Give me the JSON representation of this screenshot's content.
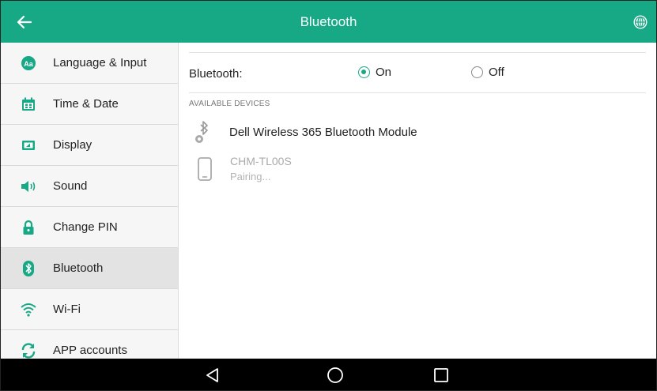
{
  "header": {
    "title": "Bluetooth",
    "back_icon": "arrow-left-icon",
    "globe_icon": "globe-icon",
    "background_color": "#17a886"
  },
  "sidebar": {
    "items": [
      {
        "label": "Language & Input",
        "icon": "language-icon",
        "active": false
      },
      {
        "label": "Time & Date",
        "icon": "calendar-icon",
        "active": false
      },
      {
        "label": "Display",
        "icon": "display-icon",
        "active": false
      },
      {
        "label": "Sound",
        "icon": "speaker-icon",
        "active": false
      },
      {
        "label": "Change PIN",
        "icon": "lock-icon",
        "active": false
      },
      {
        "label": "Bluetooth",
        "icon": "bluetooth-icon",
        "active": true
      },
      {
        "label": "Wi-Fi",
        "icon": "wifi-icon",
        "active": false
      },
      {
        "label": "APP accounts",
        "icon": "sync-icon",
        "active": false
      }
    ]
  },
  "bluetooth": {
    "label": "Bluetooth:",
    "on_label": "On",
    "off_label": "Off",
    "selected": "On"
  },
  "available_devices": {
    "header": "AVAILABLE DEVICES",
    "devices": [
      {
        "name": "Dell Wireless 365 Bluetooth Module",
        "icon": "bluetooth-device-icon",
        "status": ""
      },
      {
        "name": "CHM-TL00S",
        "icon": "phone-icon",
        "status": "Pairing..."
      }
    ]
  },
  "navbar": {
    "back_icon": "nav-back-triangle-icon",
    "home_icon": "nav-home-circle-icon",
    "recent_icon": "nav-recent-square-icon"
  },
  "colors": {
    "accent": "#17a886",
    "sidebar_bg": "#f6f6f6",
    "sidebar_active_bg": "#e3e3e3"
  }
}
